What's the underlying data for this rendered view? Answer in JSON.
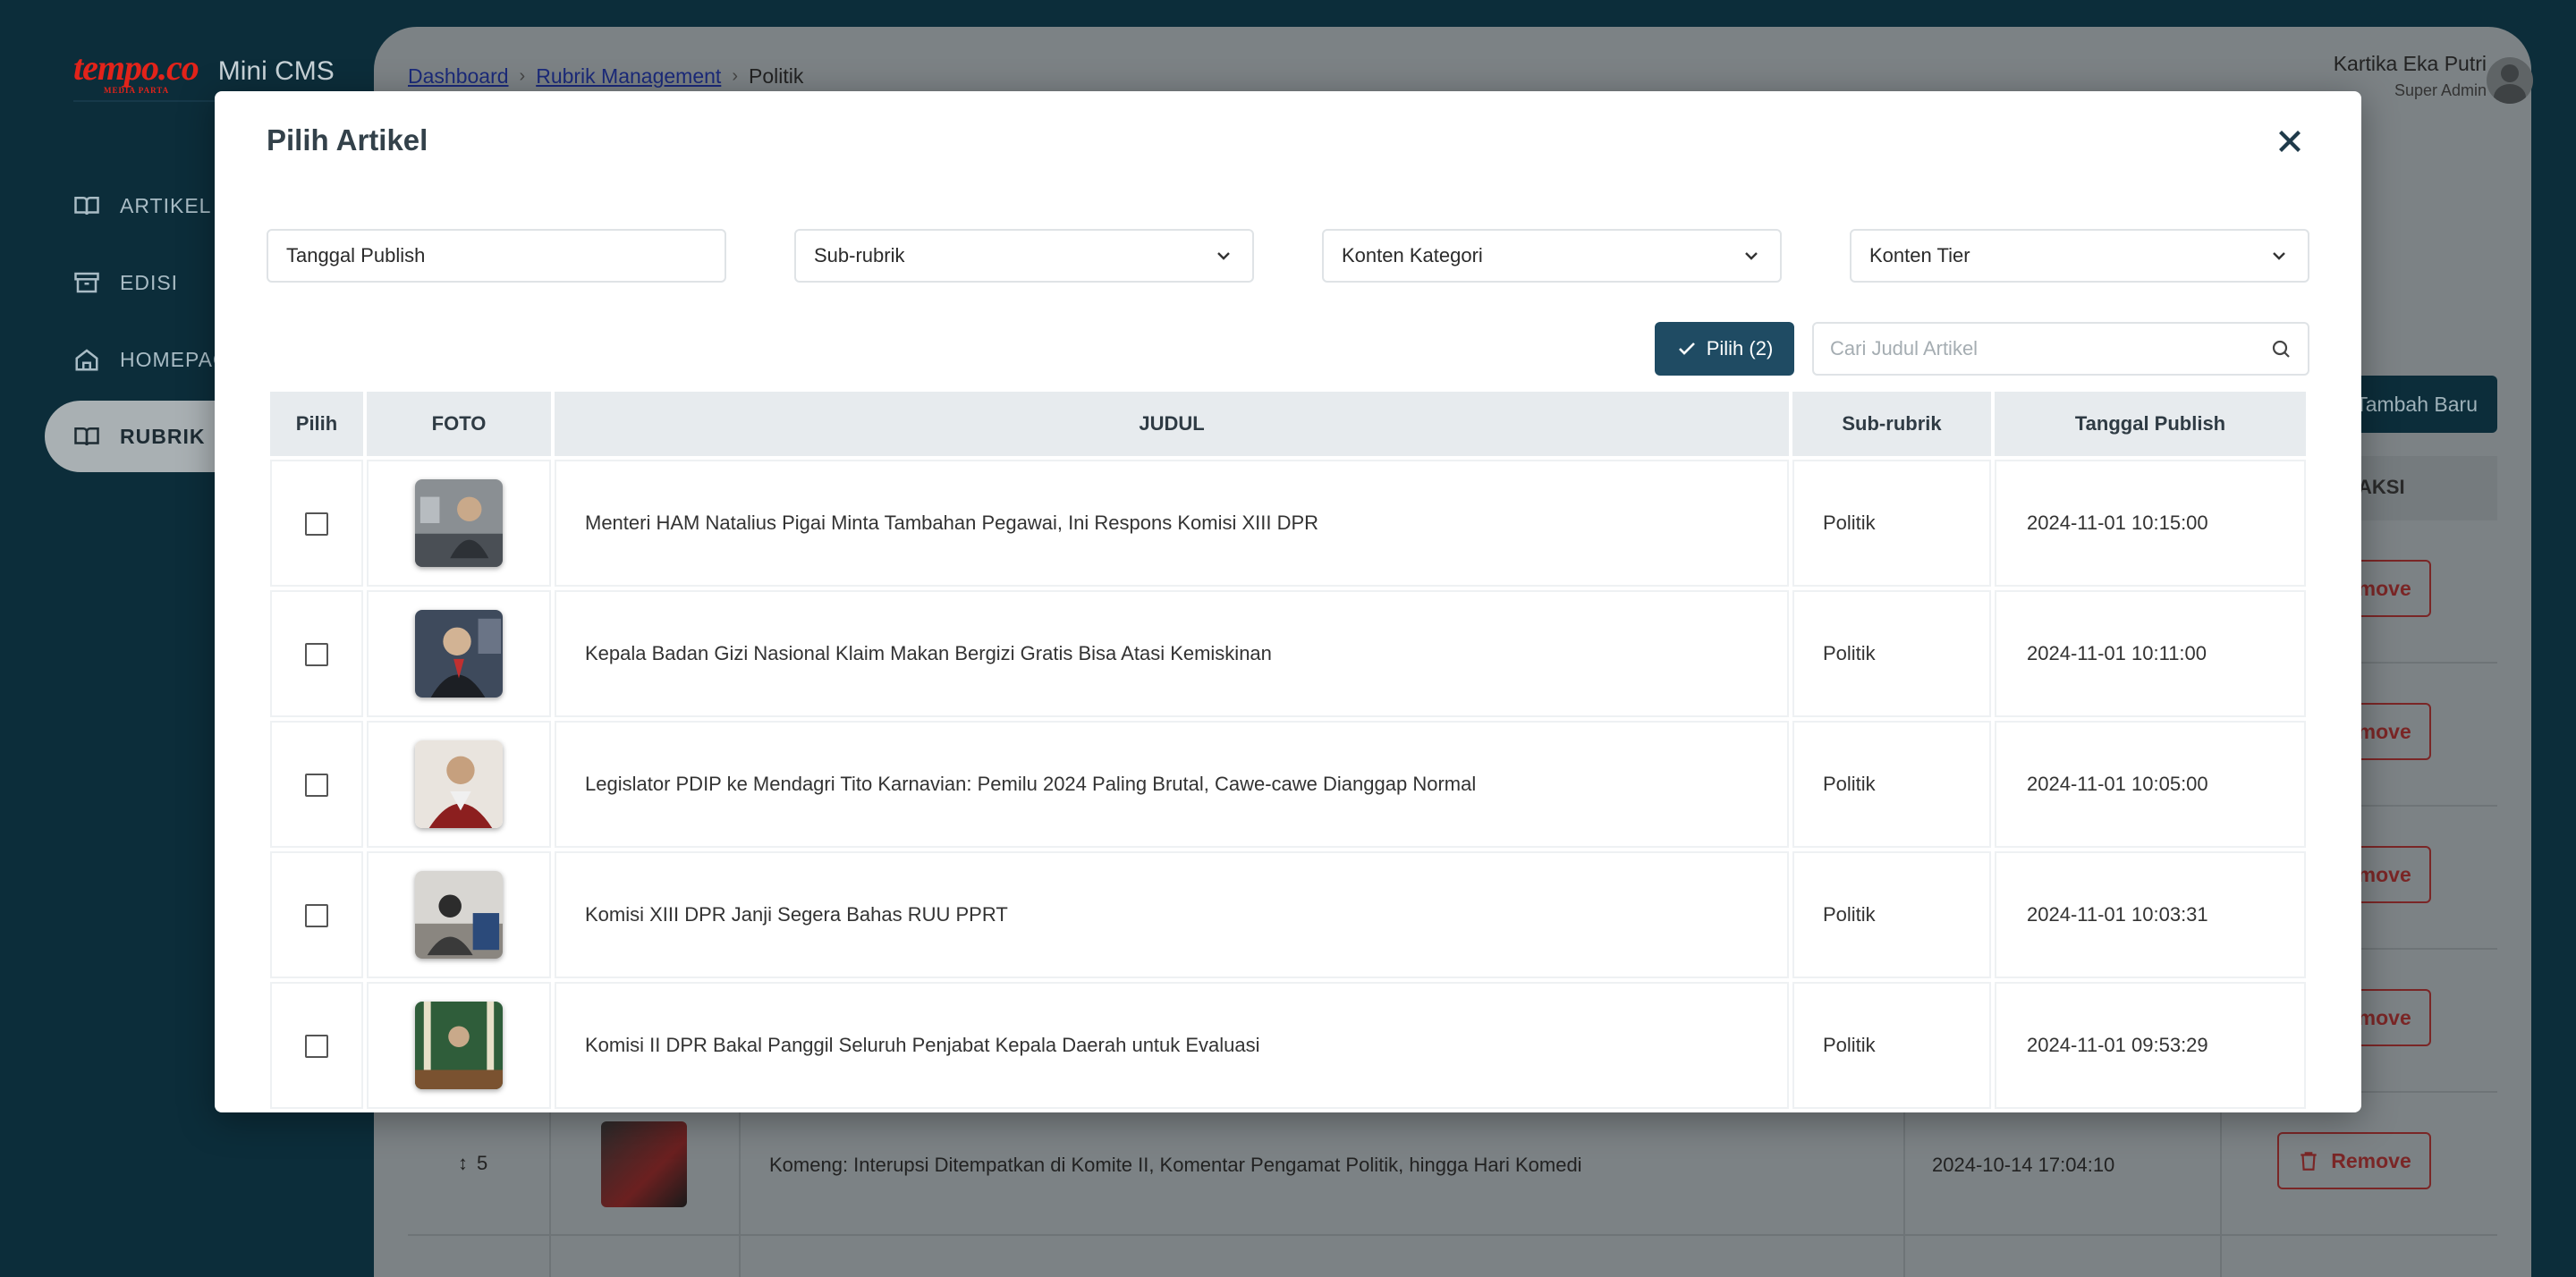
{
  "app": {
    "logo_text": "tempo.co",
    "logo_sub": "MEDIA PARTA",
    "name": "Mini CMS"
  },
  "nav": {
    "items": [
      {
        "label": "ARTIKEL",
        "icon": "book-open-icon"
      },
      {
        "label": "EDISI",
        "icon": "archive-icon"
      },
      {
        "label": "HOMEPAGE",
        "icon": "home-icon"
      },
      {
        "label": "RUBRIK",
        "icon": "book-open-icon",
        "active": true
      }
    ]
  },
  "breadcrumb": {
    "items": [
      "Dashboard",
      "Rubrik Management"
    ],
    "current": "Politik"
  },
  "user": {
    "name": "Kartika Eka Putri",
    "role": "Super Admin"
  },
  "background_page": {
    "add_button": "Tambah Baru",
    "aksi_header": "AKSI",
    "remove_label": "Remove",
    "visible_row": {
      "rank": "5",
      "title": "Komeng: Interupsi Ditempatkan di Komite II, Komentar Pengamat Politik, hingga Hari Komedi",
      "date": "2024-10-14 17:04:10"
    }
  },
  "modal": {
    "title": "Pilih Artikel",
    "filters": {
      "tanggal": "Tanggal Publish",
      "subrubrik": "Sub-rubrik",
      "kategori": "Konten Kategori",
      "tier": "Konten Tier"
    },
    "pilih_button": "Pilih (2)",
    "search_placeholder": "Cari Judul Artikel",
    "columns": {
      "pilih": "Pilih",
      "foto": "FOTO",
      "judul": "JUDUL",
      "subrubrik": "Sub-rubrik",
      "tanggal": "Tanggal Publish"
    },
    "rows": [
      {
        "title": "Menteri HAM Natalius Pigai Minta Tambahan Pegawai, Ini Respons Komisi XIII DPR",
        "subrubrik": "Politik",
        "date": "2024-11-01 10:15:00",
        "checked": false
      },
      {
        "title": "Kepala Badan Gizi Nasional Klaim Makan Bergizi Gratis Bisa Atasi Kemiskinan",
        "subrubrik": "Politik",
        "date": "2024-11-01 10:11:00",
        "checked": false
      },
      {
        "title": "Legislator PDIP ke Mendagri Tito Karnavian: Pemilu 2024 Paling Brutal, Cawe-cawe Dianggap Normal",
        "subrubrik": "Politik",
        "date": "2024-11-01 10:05:00",
        "checked": false
      },
      {
        "title": "Komisi XIII DPR Janji Segera Bahas RUU PPRT",
        "subrubrik": "Politik",
        "date": "2024-11-01 10:03:31",
        "checked": false
      },
      {
        "title": "Komisi II DPR Bakal Panggil Seluruh Penjabat Kepala Daerah untuk Evaluasi",
        "subrubrik": "Politik",
        "date": "2024-11-01 09:53:29",
        "checked": false
      }
    ]
  },
  "colors": {
    "sidebar_bg": "#0c2d3a",
    "primary_button": "#1f4b63",
    "brand_red": "#e2231a",
    "remove_red": "#7a2626"
  }
}
